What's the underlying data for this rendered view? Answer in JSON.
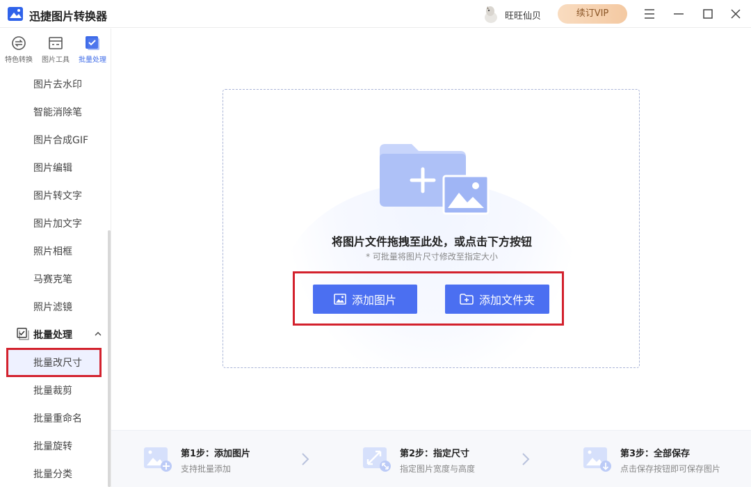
{
  "app": {
    "title": "迅捷图片转换器"
  },
  "user": {
    "name": "旺旺仙贝"
  },
  "header": {
    "vip_label": "续订VIP"
  },
  "sidebar": {
    "tabs": [
      {
        "label": "特色转换",
        "icon": "convert-icon"
      },
      {
        "label": "图片工具",
        "icon": "image-tool-icon"
      },
      {
        "label": "批量处理",
        "icon": "batch-check-icon",
        "active": true
      }
    ],
    "items": [
      "图片去水印",
      "智能消除笔",
      "图片合成GIF",
      "图片编辑",
      "图片转文字",
      "图片加文字",
      "照片相框",
      "马赛克笔",
      "照片滤镜"
    ],
    "group": {
      "label": "批量处理",
      "expanded": true
    },
    "group_items": [
      "批量改尺寸",
      "批量裁剪",
      "批量重命名",
      "批量旋转",
      "批量分类"
    ],
    "selected_item": "批量改尺寸"
  },
  "dropzone": {
    "title": "将图片文件拖拽至此处，或点击下方按钮",
    "subtitle": "* 可批量将图片尺寸修改至指定大小",
    "add_image_label": "添加图片",
    "add_folder_label": "添加文件夹"
  },
  "steps": [
    {
      "title": "第1步：添加图片",
      "desc": "支持批量添加"
    },
    {
      "title": "第2步：指定尺寸",
      "desc": "指定图片宽度与高度"
    },
    {
      "title": "第3步：全部保存",
      "desc": "点击保存按钮即可保存图片"
    }
  ],
  "colors": {
    "accent": "#4b6ff1",
    "highlight": "#d3212d",
    "vip": "#f4c9a2"
  }
}
